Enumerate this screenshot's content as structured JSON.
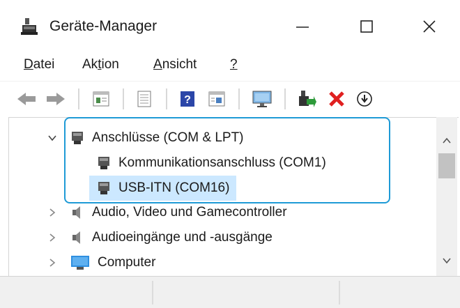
{
  "window": {
    "title": "Geräte-Manager",
    "icons": {
      "app": "device-manager-icon",
      "minimize": "minimize-icon",
      "maximize": "maximize-icon",
      "close": "close-icon"
    }
  },
  "menu": {
    "items": [
      {
        "label": "Datei",
        "accel": "D",
        "rest": "atei"
      },
      {
        "label": "Aktion",
        "pre": "Ak",
        "accel": "t",
        "rest": "ion"
      },
      {
        "label": "Ansicht",
        "accel": "A",
        "rest": "nsicht"
      },
      {
        "label": "?",
        "accel": "?",
        "rest": ""
      }
    ]
  },
  "toolbar": {
    "buttons": [
      "back-icon",
      "forward-icon",
      "properties-icon",
      "scan-icon",
      "help-icon",
      "view-icon",
      "monitor-icon",
      "update-driver-icon",
      "uninstall-icon",
      "disable-icon"
    ]
  },
  "tree": {
    "items": [
      {
        "label": "Anschlüsse (COM & LPT)",
        "icon": "port-icon",
        "state": "expanded"
      },
      {
        "label": "Kommunikationsanschluss (COM1)",
        "icon": "port-icon",
        "state": "leaf"
      },
      {
        "label": "USB-ITN (COM16)",
        "icon": "port-icon",
        "state": "selected"
      },
      {
        "label": "Audio, Video und Gamecontroller",
        "icon": "speaker-icon",
        "state": "collapsed"
      },
      {
        "label": "Audioeingänge und -ausgänge",
        "icon": "speaker-icon",
        "state": "collapsed"
      },
      {
        "label": "Computer",
        "icon": "monitor-icon",
        "state": "collapsed"
      }
    ]
  },
  "colors": {
    "selection": "#cce8ff",
    "highlight_border": "#1e9ad6",
    "uninstall": "#e02020"
  }
}
